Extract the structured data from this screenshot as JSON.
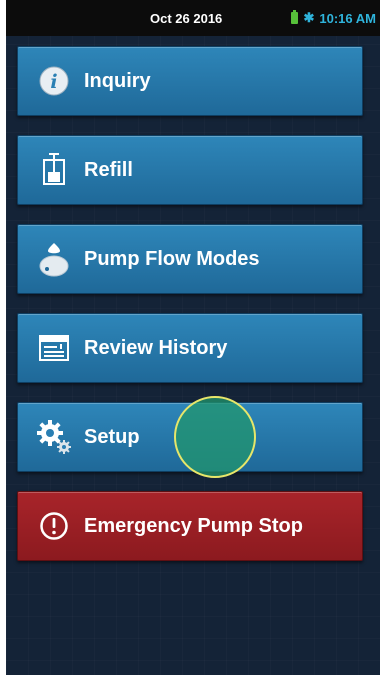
{
  "status_bar": {
    "date": "Oct 26 2016",
    "time": "10:16 AM"
  },
  "menu": {
    "inquiry": {
      "label": "Inquiry",
      "icon": "info-icon"
    },
    "refill": {
      "label": "Refill",
      "icon": "syringe-refill-icon"
    },
    "flow_modes": {
      "label": "Pump Flow Modes",
      "icon": "pump-drop-icon"
    },
    "history": {
      "label": "Review History",
      "icon": "history-log-icon"
    },
    "setup": {
      "label": "Setup",
      "icon": "gears-icon"
    },
    "emergency": {
      "label": "Emergency Pump Stop",
      "icon": "alert-circle-icon"
    }
  },
  "colors": {
    "button_blue": "#2a7fb3",
    "emergency_red": "#9b1f24",
    "background": "#142337",
    "touch_indicator": "#22966e"
  }
}
